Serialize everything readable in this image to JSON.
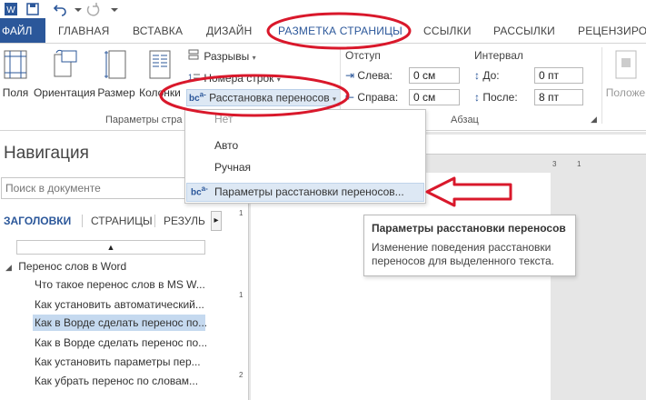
{
  "ribbon_tabs": {
    "file": "ФАЙЛ",
    "home": "ГЛАВНАЯ",
    "insert": "ВСТАВКА",
    "design": "ДИЗАЙН",
    "layout": "РАЗМЕТКА СТРАНИЦЫ",
    "references": "ССЫЛКИ",
    "mailings": "РАССЫЛКИ",
    "review": "РЕЦЕНЗИРОВ"
  },
  "ribbon": {
    "margins": "Поля",
    "orientation": "Ориентация",
    "size": "Размер",
    "columns": "Колонки",
    "breaks": "Разрывы",
    "line_numbers": "Номера строк",
    "hyphenation": "Расстановка переносов",
    "page_setup_group": "Параметры стра",
    "indent_header": "Отступ",
    "spacing_header": "Интервал",
    "left_label": "Слева:",
    "left_value": "0 см",
    "right_label": "Справа:",
    "right_value": "0 см",
    "before_label": "До:",
    "before_value": "0 пт",
    "after_label": "После:",
    "after_value": "8 пт",
    "paragraph_group": "Абзац",
    "position": "Положе"
  },
  "hyphenation_menu": {
    "none": "Нет",
    "auto": "Авто",
    "manual": "Ручная",
    "options": "Параметры расстановки переносов..."
  },
  "tooltip": {
    "title": "Параметры расстановки переносов",
    "description": "Изменение поведения расстановки переносов для выделенного текста."
  },
  "navigation": {
    "title": "Навигация",
    "search_placeholder": "Поиск в документе",
    "tabs": [
      "ЗАГОЛОВКИ",
      "СТРАНИЦЫ",
      "РЕЗУЛЬ"
    ],
    "root": "Перенос слов в Word",
    "items": [
      "Что такое перенос слов в MS W...",
      "Как установить автоматический...",
      "Как в Ворде сделать перенос по...",
      "Как в Ворде сделать перенос по...",
      "Как установить параметры пер...",
      "Как убрать перенос по словам..."
    ]
  },
  "ruler": {
    "h_mark_3": "3",
    "h_mark_1": "1",
    "v_marks": [
      "1",
      "1",
      "2"
    ]
  },
  "colors": {
    "word_blue": "#2b579a",
    "annotation_red": "#d9182b",
    "selection": "#c5d9ef"
  }
}
